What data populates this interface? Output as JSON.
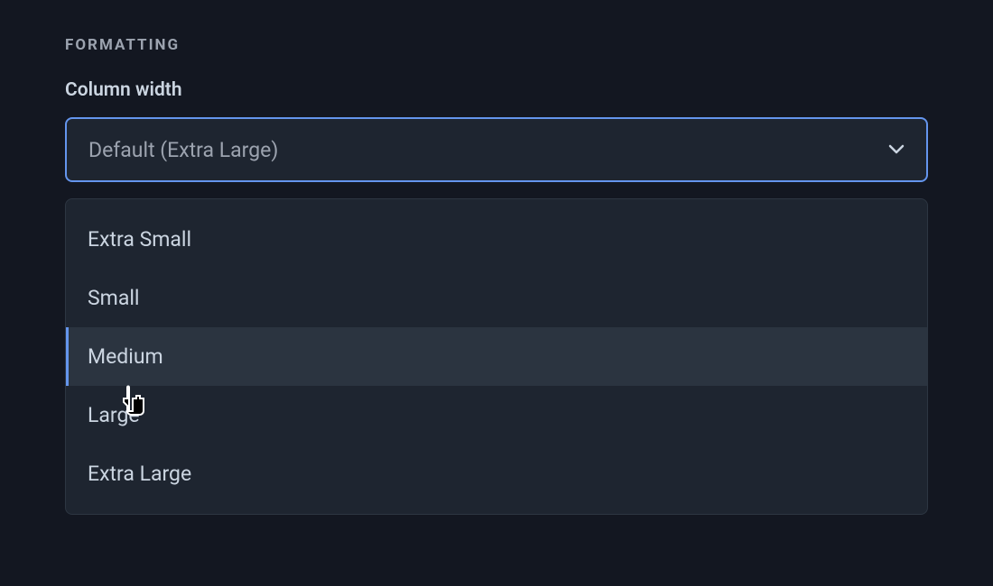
{
  "section": {
    "header": "FORMATTING"
  },
  "field": {
    "label": "Column width"
  },
  "select": {
    "value": "Default (Extra Large)"
  },
  "options": {
    "0": "Extra Small",
    "1": "Small",
    "2": "Medium",
    "3": "Large",
    "4": "Extra Large"
  }
}
